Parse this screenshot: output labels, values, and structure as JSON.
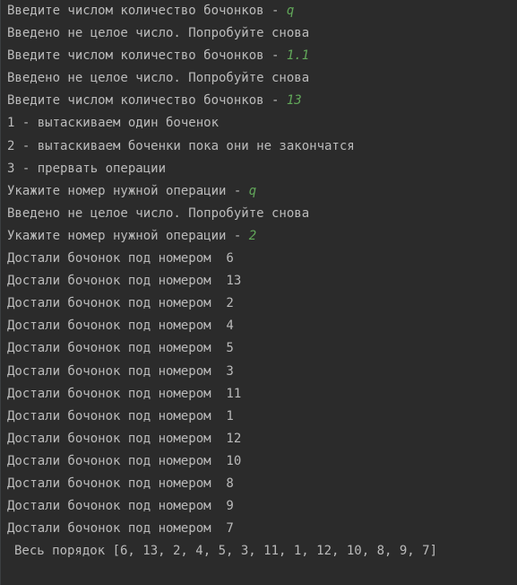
{
  "console": {
    "lines": [
      {
        "text": "Введите числом количество бочонков - ",
        "input": "q"
      },
      {
        "text": "Введено не целое число. Попробуйте снова",
        "input": ""
      },
      {
        "text": "Введите числом количество бочонков - ",
        "input": "1.1"
      },
      {
        "text": "Введено не целое число. Попробуйте снова",
        "input": ""
      },
      {
        "text": "Введите числом количество бочонков - ",
        "input": "13"
      },
      {
        "text": "1 - вытаскиваем один боченок",
        "input": ""
      },
      {
        "text": "2 - вытаскиваем боченки пока они не закончатся",
        "input": ""
      },
      {
        "text": "3 - прервать операции",
        "input": ""
      },
      {
        "text": "Укажите номер нужной операции - ",
        "input": "q"
      },
      {
        "text": "Введено не целое число. Попробуйте снова",
        "input": ""
      },
      {
        "text": "Укажите номер нужной операции - ",
        "input": "2"
      },
      {
        "text": "Достали бочонок под номером  6",
        "input": ""
      },
      {
        "text": "Достали бочонок под номером  13",
        "input": ""
      },
      {
        "text": "Достали бочонок под номером  2",
        "input": ""
      },
      {
        "text": "Достали бочонок под номером  4",
        "input": ""
      },
      {
        "text": "Достали бочонок под номером  5",
        "input": ""
      },
      {
        "text": "Достали бочонок под номером  3",
        "input": ""
      },
      {
        "text": "Достали бочонок под номером  11",
        "input": ""
      },
      {
        "text": "Достали бочонок под номером  1",
        "input": ""
      },
      {
        "text": "Достали бочонок под номером  12",
        "input": ""
      },
      {
        "text": "Достали бочонок под номером  10",
        "input": ""
      },
      {
        "text": "Достали бочонок под номером  8",
        "input": ""
      },
      {
        "text": "Достали бочонок под номером  9",
        "input": ""
      },
      {
        "text": "Достали бочонок под номером  7",
        "input": ""
      }
    ],
    "summary": "Весь порядок [6, 13, 2, 4, 5, 3, 11, 1, 12, 10, 8, 9, 7]"
  },
  "colors": {
    "background": "#2b2b2b",
    "text": "#bbbbbb",
    "user_input": "#62a85a"
  }
}
